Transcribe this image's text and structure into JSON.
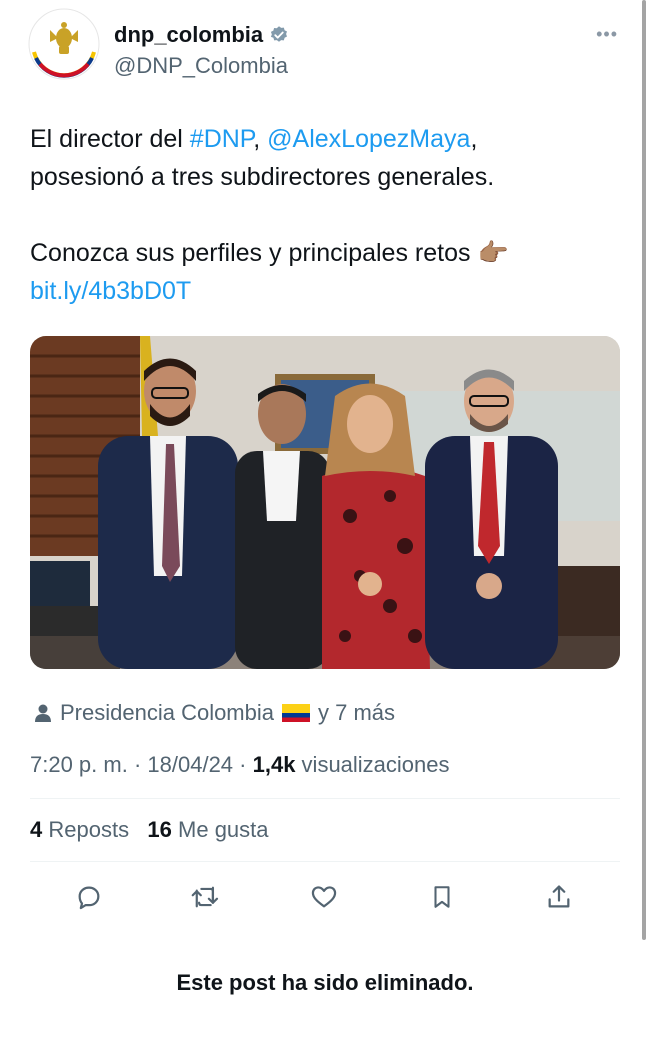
{
  "account": {
    "display_name": "dnp_colombia",
    "handle": "@DNP_Colombia",
    "verified": true,
    "more_label": "•••"
  },
  "post": {
    "line1_prefix": "El director del ",
    "hashtag": "#DNP",
    "comma": ", ",
    "mention": "@AlexLopezMaya",
    "line1_suffix": ",",
    "line2": "posesionó a tres subdirectores generales.",
    "line3": "Conozca sus perfiles y principales retos",
    "emoji": "👉🏽",
    "link": "bit.ly/4b3bD0T"
  },
  "media": {
    "description_icon": "photo-of-four-officials"
  },
  "tagged": {
    "name": "Presidencia Colombia",
    "flag": "colombia-flag",
    "others": "y 7 más"
  },
  "meta": {
    "time": "7:20 p. m.",
    "sep1": " · ",
    "date": "18/04/24",
    "sep2": " · ",
    "views": "1,4k",
    "views_label": " visualizaciones"
  },
  "stats": {
    "reposts": "4",
    "reposts_label": " Reposts",
    "likes": "16",
    "likes_label": " Me gusta"
  },
  "actions": [
    "reply-icon",
    "repost-icon",
    "like-icon",
    "bookmark-icon",
    "share-icon"
  ],
  "footer": {
    "deleted_notice": "Este post ha sido eliminado."
  },
  "colors": {
    "link": "#1d9bf0",
    "text": "#0f1419",
    "muted": "#536471"
  }
}
